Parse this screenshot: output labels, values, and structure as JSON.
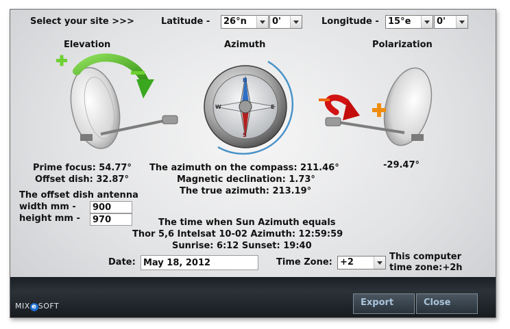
{
  "header": {
    "select_site": "Select your site >>>",
    "latitude_label": "Latitude -",
    "latitude_deg": "26°n",
    "latitude_min": "0'",
    "longitude_label": "Longitude -",
    "longitude_deg": "15°e",
    "longitude_min": "0'"
  },
  "sections": {
    "elevation": "Elevation",
    "azimuth": "Azimuth",
    "polarization": "Polarization"
  },
  "compass": {
    "n": "N",
    "e": "E",
    "s": "S",
    "w": "W"
  },
  "elevation": {
    "prime_focus": "Prime focus: 54.77°",
    "offset_dish": "Offset dish: 32.87°"
  },
  "azimuth": {
    "compass": "The azimuth on the compass: 211.46°",
    "declination": "Magnetic declination: 1.73°",
    "true": "The true azimuth: 213.19°"
  },
  "polarization": {
    "value": "-29.47°"
  },
  "antenna": {
    "title": "The offset dish antenna",
    "width_label": "width  mm -",
    "width_value": "900",
    "height_label": "height mm -",
    "height_value": "970"
  },
  "sun": {
    "title": "The time when Sun Azimuth equals",
    "line1": "Thor 5,6   Intelsat 10-02 Azimuth: 12:59:59",
    "line2": "Sunrise: 6:12  Sunset: 19:40"
  },
  "date": {
    "label": "Date:",
    "value": "May 18, 2012"
  },
  "timezone": {
    "label": "Time Zone:",
    "value": "+2",
    "computer_line1": "This computer",
    "computer_line2": "time zone:+2h"
  },
  "footer": {
    "brand_pre": "MIX",
    "brand_mid": "e",
    "brand_post": "SOFT",
    "export": "Export",
    "close": "Close"
  },
  "colors": {
    "green": "#3aa81f",
    "orange": "#ee6a10",
    "red": "#cc1010",
    "footer": "#1f252b",
    "button_text": "#a9c4dc"
  }
}
